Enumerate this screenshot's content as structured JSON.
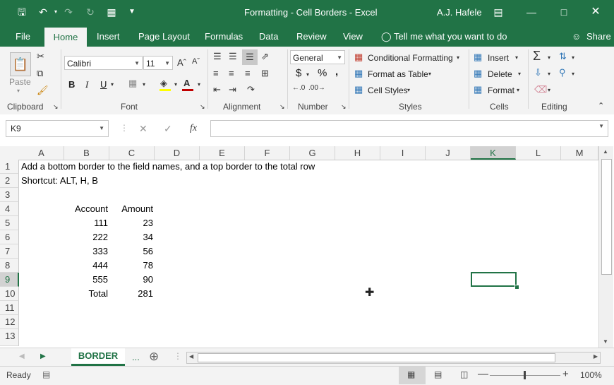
{
  "window": {
    "title": "Formatting - Cell Borders  -  Excel",
    "user": "A.J. Hafele"
  },
  "tabs": [
    "File",
    "Home",
    "Insert",
    "Page Layout",
    "Formulas",
    "Data",
    "Review",
    "View"
  ],
  "tell_me": "Tell me what you want to do",
  "share": "Share",
  "ribbon": {
    "clipboard": {
      "label": "Clipboard",
      "paste": "Paste"
    },
    "font": {
      "label": "Font",
      "name": "Calibri",
      "size": "11",
      "bold": "B",
      "italic": "I",
      "underline": "U"
    },
    "alignment": {
      "label": "Alignment"
    },
    "number": {
      "label": "Number",
      "format": "General",
      "currency": "$",
      "percent": "%",
      "comma": ","
    },
    "styles": {
      "label": "Styles",
      "conditional": "Conditional Formatting",
      "format_table": "Format as Table",
      "cell_styles": "Cell Styles"
    },
    "cells": {
      "label": "Cells",
      "insert": "Insert",
      "delete": "Delete",
      "format": "Format"
    },
    "editing": {
      "label": "Editing"
    }
  },
  "namebox": "K9",
  "fx": "fx",
  "columns": [
    "A",
    "B",
    "C",
    "D",
    "E",
    "F",
    "G",
    "H",
    "I",
    "J",
    "K",
    "L",
    "M"
  ],
  "rows": [
    "1",
    "2",
    "3",
    "4",
    "5",
    "6",
    "7",
    "8",
    "9",
    "10",
    "11",
    "12",
    "13"
  ],
  "cells": {
    "a1": "Add a bottom border to the field names, and a top border to the total row",
    "a2": "Shortcut: ALT, H, B",
    "b4": "Account",
    "c4": "Amount",
    "b5": "111",
    "c5": "23",
    "b6": "222",
    "c6": "34",
    "b7": "333",
    "c7": "56",
    "b8": "444",
    "c8": "78",
    "b9": "555",
    "c9": "90",
    "b10": "Total",
    "c10": "281"
  },
  "sheet_tab": "BORDER",
  "sheet_more": "...",
  "status": "Ready",
  "zoom": "100%",
  "colors": {
    "accent": "#217346",
    "selection": "#217346"
  }
}
